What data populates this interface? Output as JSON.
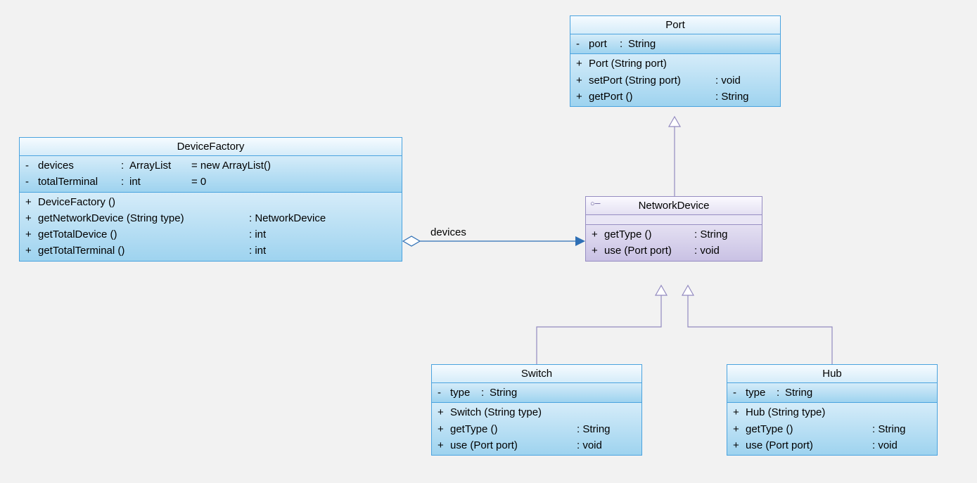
{
  "classes": {
    "port": {
      "name": "Port",
      "attrs": [
        {
          "vis": "-",
          "name": "port",
          "type": "String"
        }
      ],
      "ops": [
        {
          "vis": "+",
          "sig": "Port (String port)",
          "ret": ""
        },
        {
          "vis": "+",
          "sig": "setPort (String port)",
          "ret": "void"
        },
        {
          "vis": "+",
          "sig": "getPort ()",
          "ret": "String"
        }
      ]
    },
    "deviceFactory": {
      "name": "DeviceFactory",
      "attrs": [
        {
          "vis": "-",
          "name": "devices",
          "type": "ArrayList",
          "init": "= new ArrayList()"
        },
        {
          "vis": "-",
          "name": "totalTerminal",
          "type": "int",
          "init": "= 0"
        }
      ],
      "ops": [
        {
          "vis": "+",
          "sig": "DeviceFactory ()",
          "ret": ""
        },
        {
          "vis": "+",
          "sig": "getNetworkDevice (String type)",
          "ret": "NetworkDevice"
        },
        {
          "vis": "+",
          "sig": "getTotalDevice ()",
          "ret": "int"
        },
        {
          "vis": "+",
          "sig": "getTotalTerminal ()",
          "ret": "int"
        }
      ]
    },
    "networkDevice": {
      "name": "NetworkDevice",
      "ops": [
        {
          "vis": "+",
          "sig": "getType ()",
          "ret": "String"
        },
        {
          "vis": "+",
          "sig": "use (Port port)",
          "ret": "void"
        }
      ]
    },
    "switch": {
      "name": "Switch",
      "attrs": [
        {
          "vis": "-",
          "name": "type",
          "type": "String"
        }
      ],
      "ops": [
        {
          "vis": "+",
          "sig": "Switch (String type)",
          "ret": ""
        },
        {
          "vis": "+",
          "sig": "getType ()",
          "ret": "String"
        },
        {
          "vis": "+",
          "sig": "use (Port port)",
          "ret": "void"
        }
      ]
    },
    "hub": {
      "name": "Hub",
      "attrs": [
        {
          "vis": "-",
          "name": "type",
          "type": "String"
        }
      ],
      "ops": [
        {
          "vis": "+",
          "sig": "Hub (String type)",
          "ret": ""
        },
        {
          "vis": "+",
          "sig": "getType ()",
          "ret": "String"
        },
        {
          "vis": "+",
          "sig": "use (Port port)",
          "ret": "void"
        }
      ]
    }
  },
  "relations": {
    "aggregation_label": "devices"
  }
}
